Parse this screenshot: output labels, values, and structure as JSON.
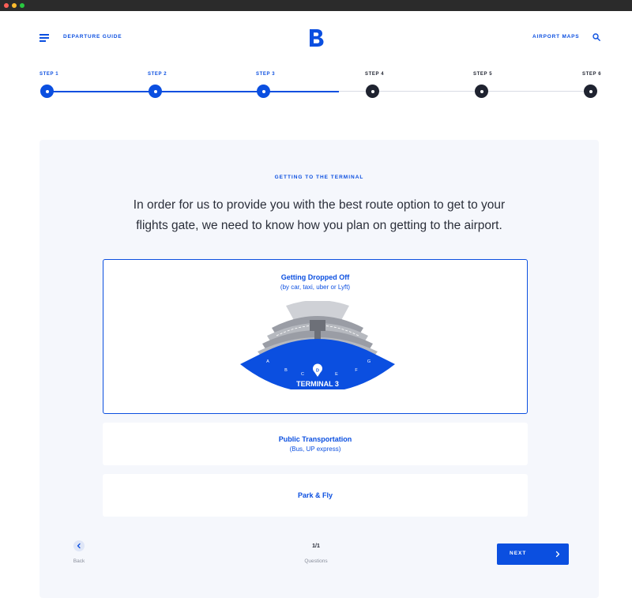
{
  "colors": {
    "accent": "#0b4fe0",
    "dark": "#1f2330",
    "panel": "#f5f7fc"
  },
  "header": {
    "menu_icon": "hamburger-menu-icon",
    "left_link": "DEPARTURE GUIDE",
    "logo": "B",
    "right_link": "AIRPORT MAPS",
    "search_icon": "search-icon"
  },
  "stepper": {
    "current_step": 3,
    "total_steps": 6,
    "steps": [
      {
        "label": "STEP 1",
        "state": "complete"
      },
      {
        "label": "STEP 2",
        "state": "complete"
      },
      {
        "label": "STEP 3",
        "state": "current"
      },
      {
        "label": "STEP 4",
        "state": "upcoming"
      },
      {
        "label": "STEP 5",
        "state": "upcoming"
      },
      {
        "label": "STEP 6",
        "state": "upcoming"
      }
    ]
  },
  "main": {
    "eyebrow": "GETTING TO THE TERMINAL",
    "lead": "In order for us to provide you with the best route option to get to your flights gate, we need to know how you plan on getting to the airport.",
    "options": [
      {
        "title": "Getting Dropped Off",
        "subtitle": "(by car, taxi, uber or Lyft)",
        "selected": true,
        "map": {
          "terminal_label": "TERMINAL 3",
          "gates": [
            "A",
            "B",
            "C",
            "D",
            "E",
            "F",
            "G"
          ],
          "pin_gate": "D"
        }
      },
      {
        "title": "Public Transportation",
        "subtitle": "(Bus, UP express)",
        "selected": false
      },
      {
        "title": "Park & Fly",
        "selected": false
      }
    ]
  },
  "footer": {
    "back_label": "Back",
    "counter": "1/1",
    "counter_label": "Questions",
    "next_label": "NEXT"
  }
}
